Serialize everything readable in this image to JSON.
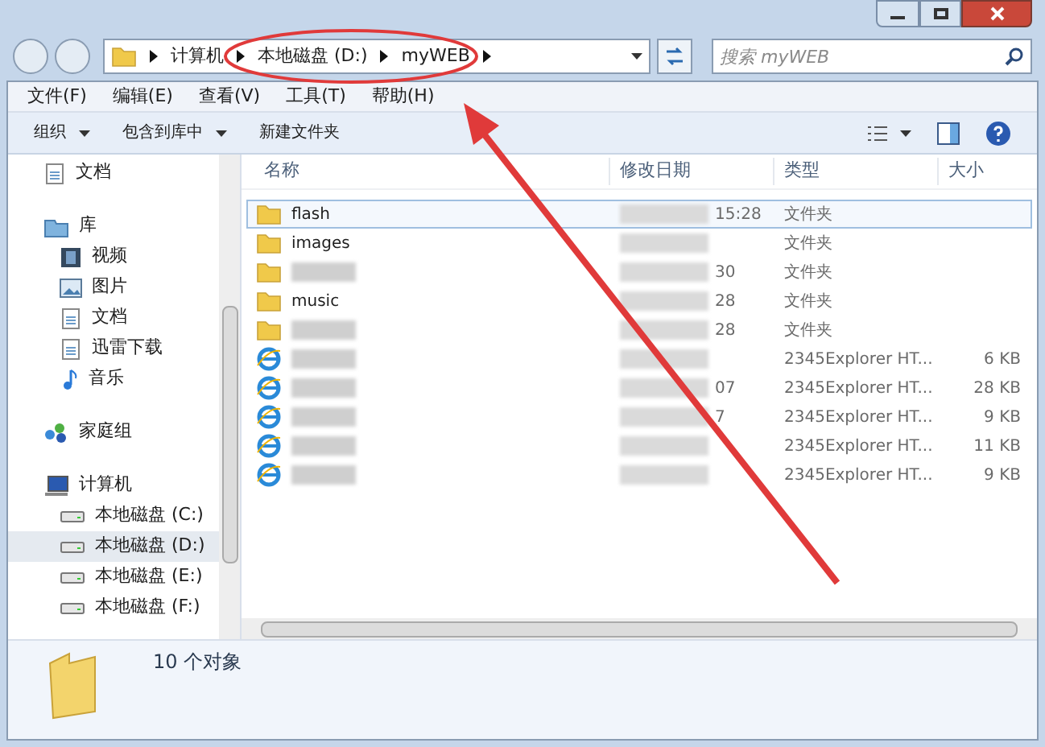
{
  "address": {
    "path": [
      "计算机",
      "本地磁盘 (D:)",
      "myWEB"
    ]
  },
  "search": {
    "placeholder": "搜索 myWEB"
  },
  "menu": [
    "文件(F)",
    "编辑(E)",
    "查看(V)",
    "工具(T)",
    "帮助(H)"
  ],
  "toolbar": [
    {
      "label": "组织",
      "dropdown": true
    },
    {
      "label": "包含到库中",
      "dropdown": true
    },
    {
      "label": "新建文件夹",
      "dropdown": false
    }
  ],
  "nav": [
    {
      "label": "文档",
      "kind": "doc",
      "selected": false
    },
    {
      "label": "库",
      "kind": "library",
      "selected": false,
      "children": [
        {
          "label": "视频",
          "kind": "video",
          "selected": false
        },
        {
          "label": "图片",
          "kind": "picture",
          "selected": false
        },
        {
          "label": "文档",
          "kind": "doc",
          "selected": false
        },
        {
          "label": "迅雷下载",
          "kind": "doc",
          "selected": false
        },
        {
          "label": "音乐",
          "kind": "music",
          "selected": false
        }
      ]
    },
    {
      "label": "家庭组",
      "kind": "homegroup",
      "selected": false
    },
    {
      "label": "计算机",
      "kind": "computer",
      "selected": false,
      "children": [
        {
          "label": "本地磁盘 (C:)",
          "kind": "drive",
          "selected": false
        },
        {
          "label": "本地磁盘 (D:)",
          "kind": "drive",
          "selected": true
        },
        {
          "label": "本地磁盘 (E:)",
          "kind": "drive",
          "selected": false
        },
        {
          "label": "本地磁盘 (F:)",
          "kind": "drive",
          "selected": false
        }
      ]
    }
  ],
  "columns": [
    "名称",
    "修改日期",
    "类型",
    "大小"
  ],
  "rows": [
    {
      "kind": "folder",
      "name": "flash",
      "date": "15:28",
      "type": "文件夹",
      "selected": true
    },
    {
      "kind": "folder",
      "name": "images",
      "type": "文件夹",
      "selected": false
    },
    {
      "kind": "folder",
      "date": "30",
      "type": "文件夹",
      "selected": false
    },
    {
      "kind": "folder",
      "name": "music",
      "date": "28",
      "type": "文件夹",
      "selected": false
    },
    {
      "kind": "folder",
      "date": "28",
      "type": "文件夹",
      "selected": false
    },
    {
      "kind": "html",
      "type": "2345Explorer HT...",
      "size": "6 KB",
      "selected": false
    },
    {
      "kind": "html",
      "date": "07",
      "type": "2345Explorer HT...",
      "size": "28 KB",
      "selected": false
    },
    {
      "kind": "html",
      "date": "7",
      "type": "2345Explorer HT...",
      "size": "9 KB",
      "selected": false
    },
    {
      "kind": "html",
      "type": "2345Explorer HT...",
      "size": "11 KB",
      "selected": false
    },
    {
      "kind": "html",
      "type": "2345Explorer HT...",
      "size": "9 KB",
      "selected": false
    }
  ],
  "status": {
    "count": "10 个对象"
  }
}
